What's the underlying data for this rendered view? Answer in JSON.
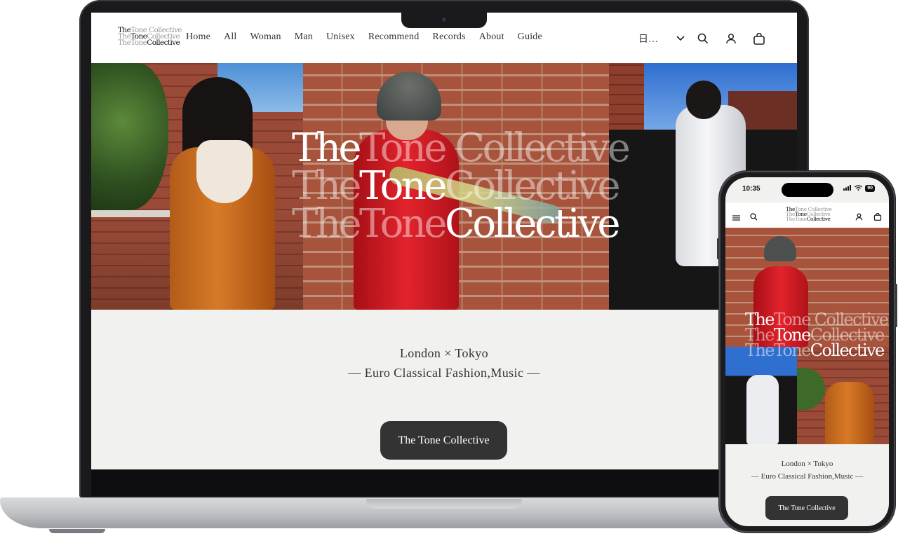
{
  "brand": {
    "logo_lines": [
      {
        "bold": "The",
        "rest": "Tone Collective"
      },
      {
        "pre": "The",
        "bold": "Tone",
        "rest": "Collective"
      },
      {
        "pre": "TheTone",
        "bold": "Collective"
      }
    ]
  },
  "nav": {
    "items": [
      "Home",
      "All",
      "Woman",
      "Man",
      "Unisex",
      "Recommend",
      "Records",
      "About",
      "Guide"
    ]
  },
  "header": {
    "language_label": "日…",
    "icons": [
      "chevron-down-icon",
      "search-icon",
      "account-icon",
      "cart-icon"
    ]
  },
  "hero": {
    "title_lines": [
      {
        "bold": "The",
        "rest": "Tone Collective"
      },
      {
        "pre": "The",
        "bold": "Tone",
        "rest": "Collective"
      },
      {
        "pre": "TheTone",
        "bold": "Collective"
      }
    ]
  },
  "tagline": {
    "line1": "London × Tokyo",
    "line2": "— Euro Classical Fashion,Music —"
  },
  "cta": {
    "label": "The Tone Collective"
  },
  "phone": {
    "status": {
      "time": "10:35",
      "battery": "90"
    },
    "icons": [
      "menu-icon",
      "search-icon",
      "account-icon",
      "cart-icon"
    ]
  },
  "colors": {
    "page_bg": "#f1f1ef",
    "header_bg": "#ffffff",
    "button_bg": "#333333",
    "button_text": "#ffffff",
    "text": "#333333"
  }
}
